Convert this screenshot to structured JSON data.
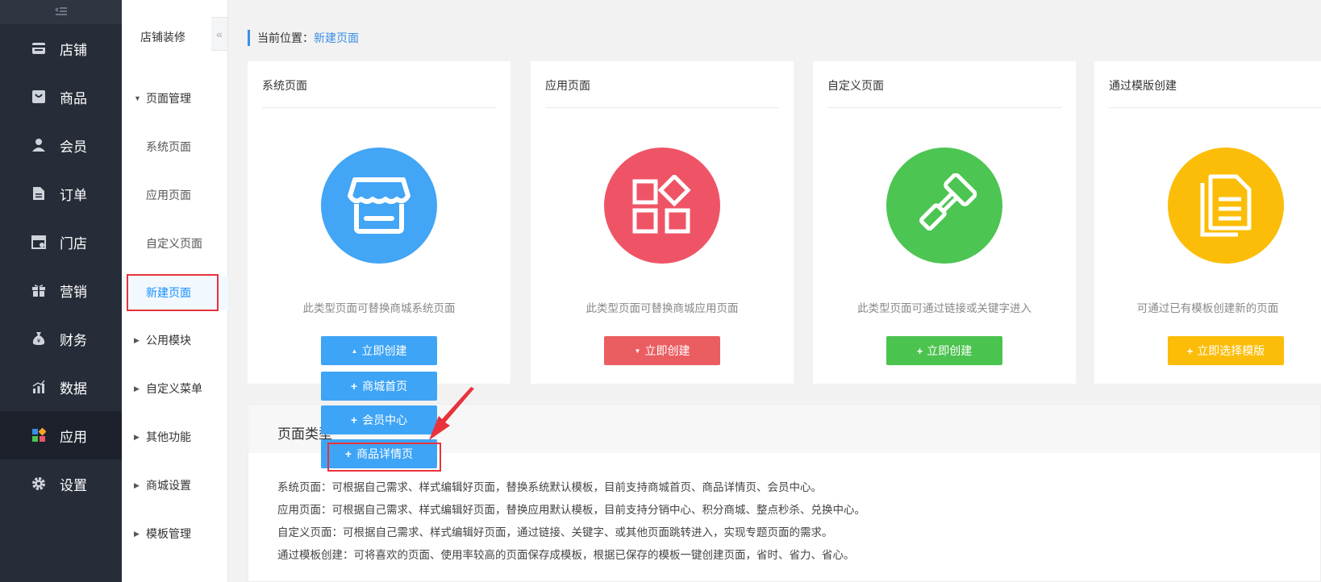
{
  "nav": {
    "toggle_icon": "collapse-menu-icon",
    "items": [
      {
        "label": "店铺",
        "icon": "store-icon"
      },
      {
        "label": "商品",
        "icon": "shopping-bag-icon"
      },
      {
        "label": "会员",
        "icon": "user-icon"
      },
      {
        "label": "订单",
        "icon": "document-icon"
      },
      {
        "label": "门店",
        "icon": "shop-icon"
      },
      {
        "label": "营销",
        "icon": "gift-icon"
      },
      {
        "label": "财务",
        "icon": "money-bag-icon"
      },
      {
        "label": "数据",
        "icon": "bar-chart-icon"
      },
      {
        "label": "应用",
        "icon": "apps-icon",
        "active": true
      },
      {
        "label": "设置",
        "icon": "gear-icon"
      }
    ]
  },
  "sub": {
    "title": "店铺装修",
    "groups": {
      "page_manage": "页面管理",
      "public_module": "公用模块",
      "custom_menu": "自定义菜单",
      "other": "其他功能",
      "mall_settings": "商城设置",
      "template_manage": "模板管理"
    },
    "items": {
      "system": "系统页面",
      "app": "应用页面",
      "custom": "自定义页面",
      "new": "新建页面"
    }
  },
  "breadcrumb": {
    "prefix": "当前位置：",
    "current": "新建页面"
  },
  "cards": [
    {
      "title": "系统页面",
      "desc": "此类型页面可替换商城系统页面",
      "button": "立即创建",
      "button_icon": "▲",
      "color": "#42a5f5",
      "btn_color": "#3ea4f5",
      "icon": "storefront-icon"
    },
    {
      "title": "应用页面",
      "desc": "此类型页面可替换商城应用页面",
      "button": "立即创建",
      "button_icon": "▼",
      "color": "#ef5466",
      "btn_color": "#ea5e62",
      "icon": "app-grid-icon"
    },
    {
      "title": "自定义页面",
      "desc": "此类型页面可通过链接或关键字进入",
      "button": "立即创建",
      "button_icon": "+",
      "color": "#4cc552",
      "btn_color": "#4bc34f",
      "icon": "paint-roller-icon"
    },
    {
      "title": "通过模版创建",
      "desc": "可通过已有模板创建新的页面",
      "button": "立即选择模版",
      "button_icon": "+",
      "color": "#fbbd08",
      "btn_color": "#fbbd08",
      "icon": "documents-icon"
    }
  ],
  "dropdown": [
    "商城首页",
    "会员中心",
    "商品详情页"
  ],
  "info": {
    "title": "页面类型",
    "lines": [
      "系统页面：可根据自己需求、样式编辑好页面，替换系统默认模板，目前支持商城首页、商品详情页、会员中心。",
      "应用页面：可根据自己需求、样式编辑好页面，替换应用默认模板，目前支持分销中心、积分商城、整点秒杀、兑换中心。",
      "自定义页面：可根据自己需求、样式编辑好页面，通过链接、关键字、或其他页面跳转进入，实现专题页面的需求。",
      "通过模板创建：可将喜欢的页面、使用率较高的页面保存成模板，根据已保存的模板一键创建页面，省时、省力、省心。"
    ]
  },
  "colors": {
    "accent": "#3a8ee6",
    "highlight": "#e8323c",
    "nav_bg": "#262c38"
  }
}
